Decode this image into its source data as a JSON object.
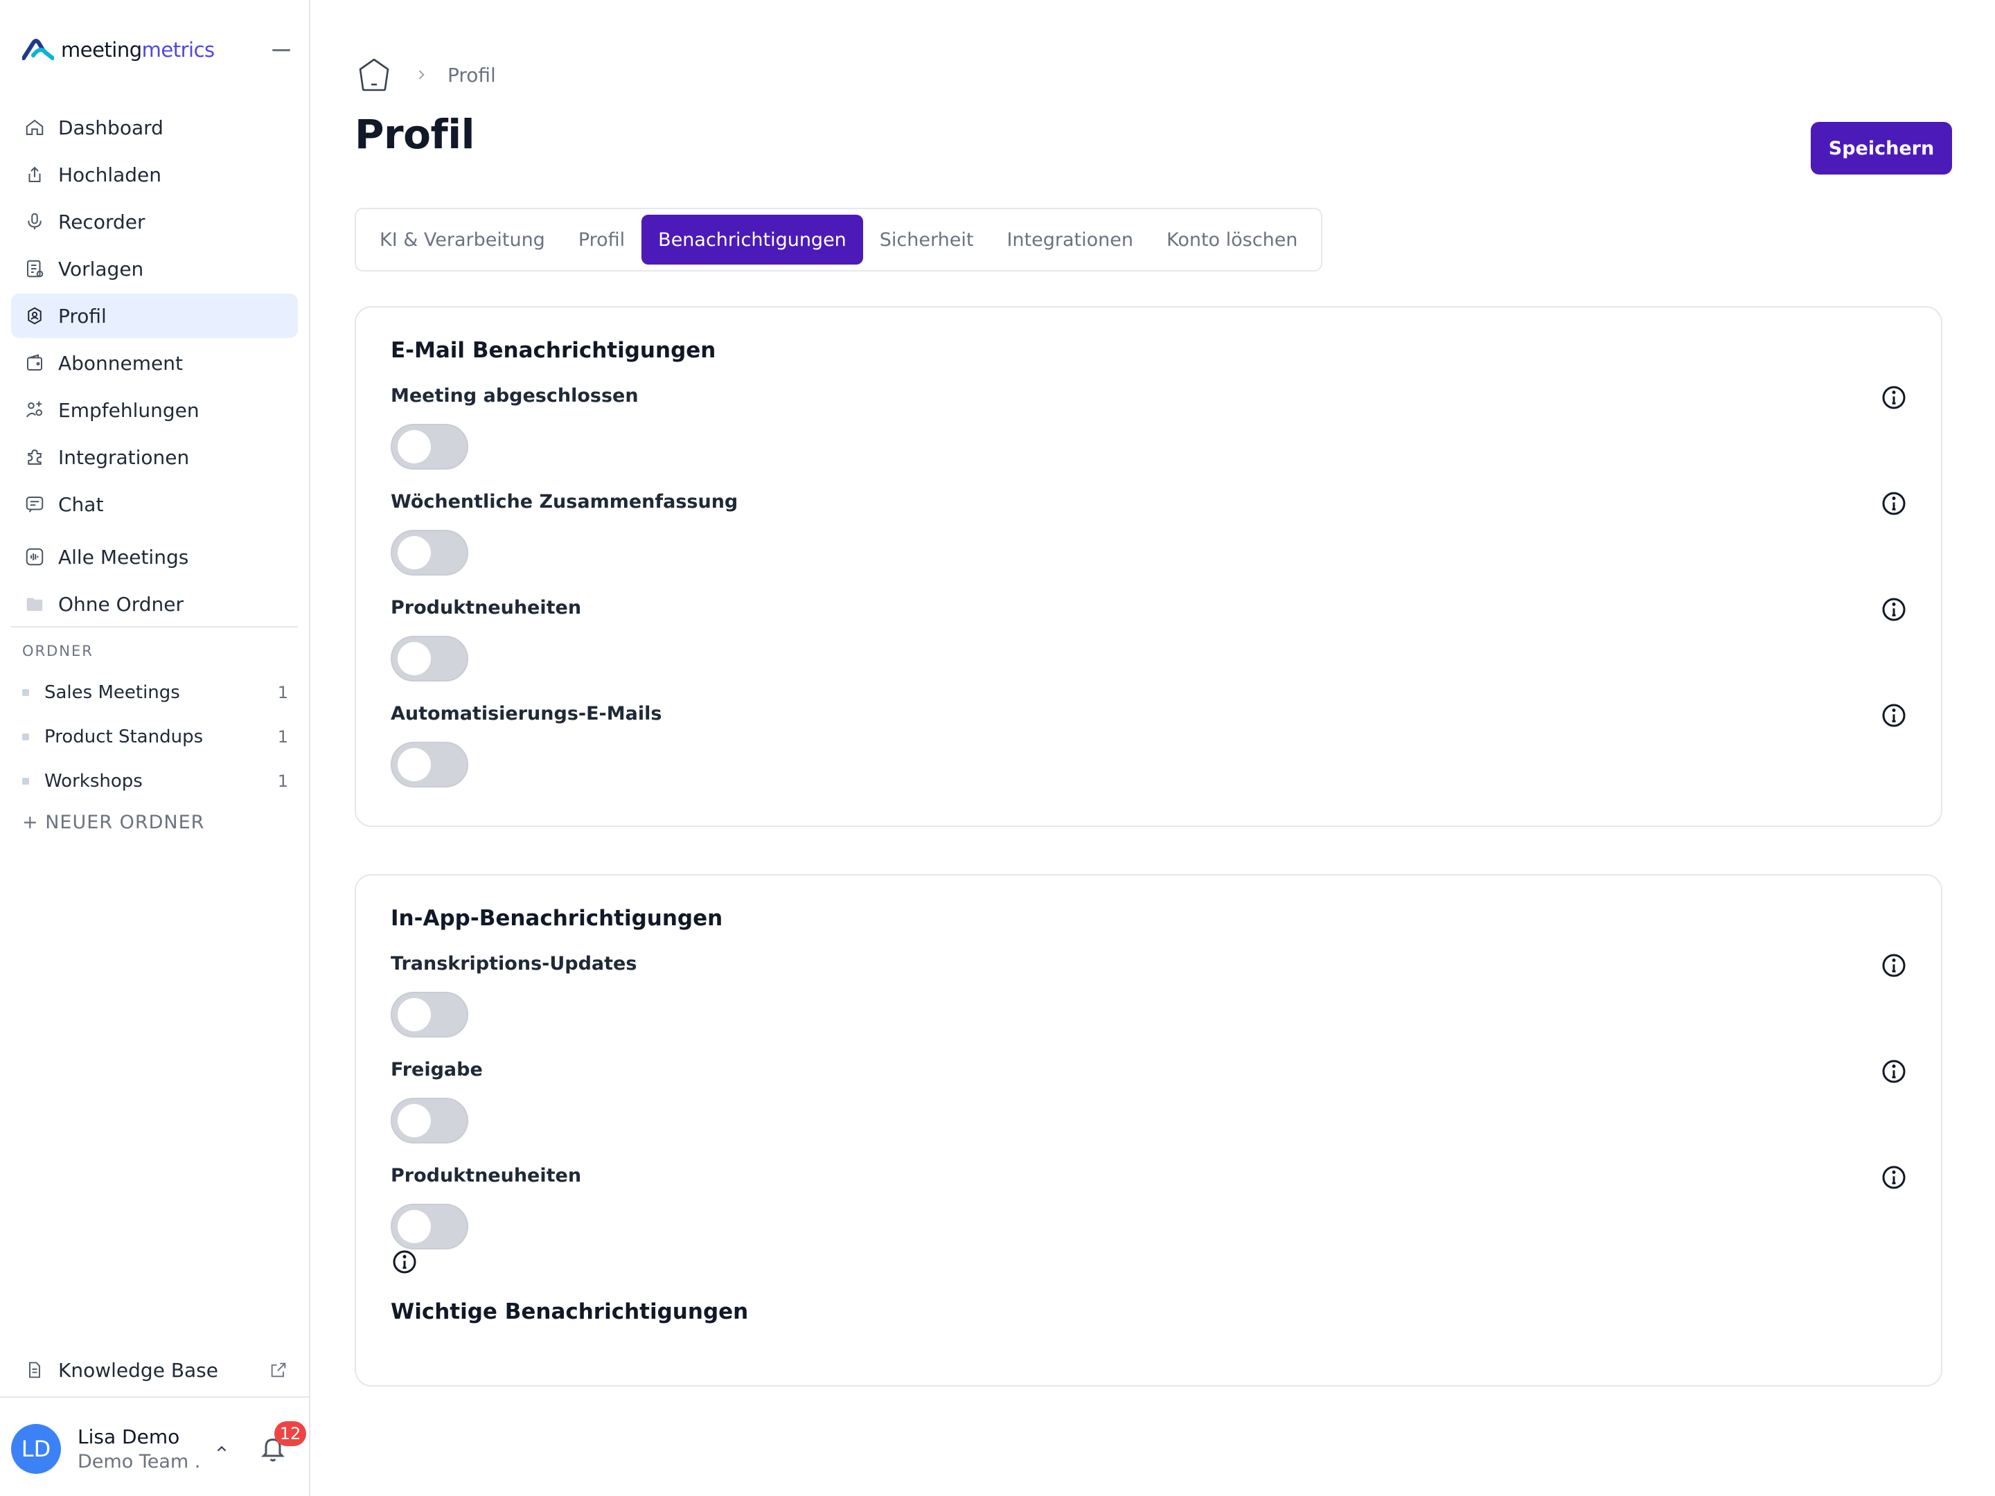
{
  "brand": {
    "name_part1": "meeting",
    "name_part2": "metrics",
    "accent": "#4f46e5"
  },
  "sidebar": {
    "nav": [
      {
        "label": "Dashboard",
        "icon": "home-icon"
      },
      {
        "label": "Hochladen",
        "icon": "upload-icon"
      },
      {
        "label": "Recorder",
        "icon": "microphone-icon"
      },
      {
        "label": "Vorlagen",
        "icon": "template-icon"
      },
      {
        "label": "Profil",
        "icon": "profile-gear-icon",
        "active": true
      },
      {
        "label": "Abonnement",
        "icon": "wallet-icon"
      },
      {
        "label": "Empfehlungen",
        "icon": "referral-icon"
      },
      {
        "label": "Integrationen",
        "icon": "puzzle-icon"
      },
      {
        "label": "Chat",
        "icon": "chat-icon"
      },
      {
        "label": "Alle Meetings",
        "icon": "audio-wave-icon"
      },
      {
        "label": "Ohne Ordner",
        "icon": "folder-icon"
      }
    ],
    "folders_title": "ORDNER",
    "folders": [
      {
        "name": "Sales Meetings",
        "count": "1"
      },
      {
        "name": "Product Standups",
        "count": "1"
      },
      {
        "name": "Workshops",
        "count": "1"
      }
    ],
    "new_folder": "+ NEUER ORDNER",
    "knowledge_base": "Knowledge Base",
    "user": {
      "initials": "LD",
      "name": "Lisa Demo",
      "team": "Demo Team ...",
      "notifications": "12"
    }
  },
  "main": {
    "breadcrumb": {
      "current": "Profil"
    },
    "title": "Profil",
    "save_label": "Speichern",
    "tabs": [
      {
        "label": "KI & Verarbeitung"
      },
      {
        "label": "Profil"
      },
      {
        "label": "Benachrichtigungen",
        "active": true
      },
      {
        "label": "Sicherheit"
      },
      {
        "label": "Integrationen"
      },
      {
        "label": "Konto löschen"
      }
    ],
    "email_section": {
      "title": "E-Mail Benachrichtigungen",
      "settings": [
        {
          "label": "Meeting abgeschlossen",
          "enabled": false
        },
        {
          "label": "Wöchentliche Zusammenfassung",
          "enabled": false
        },
        {
          "label": "Produktneuheiten",
          "enabled": false
        },
        {
          "label": "Automatisierungs-E-Mails",
          "enabled": false
        }
      ]
    },
    "inapp_section": {
      "title": "In-App-Benachrichtigungen",
      "settings": [
        {
          "label": "Transkriptions-Updates",
          "enabled": false
        },
        {
          "label": "Freigabe",
          "enabled": false
        },
        {
          "label": "Produktneuheiten",
          "enabled": false
        }
      ],
      "important_title": "Wichtige Benachrichtigungen"
    },
    "colors": {
      "primary": "#4c1ab8",
      "active_nav_bg": "#e8efff",
      "toggle_off": "#d1d5db",
      "badge": "#ef4444"
    }
  }
}
